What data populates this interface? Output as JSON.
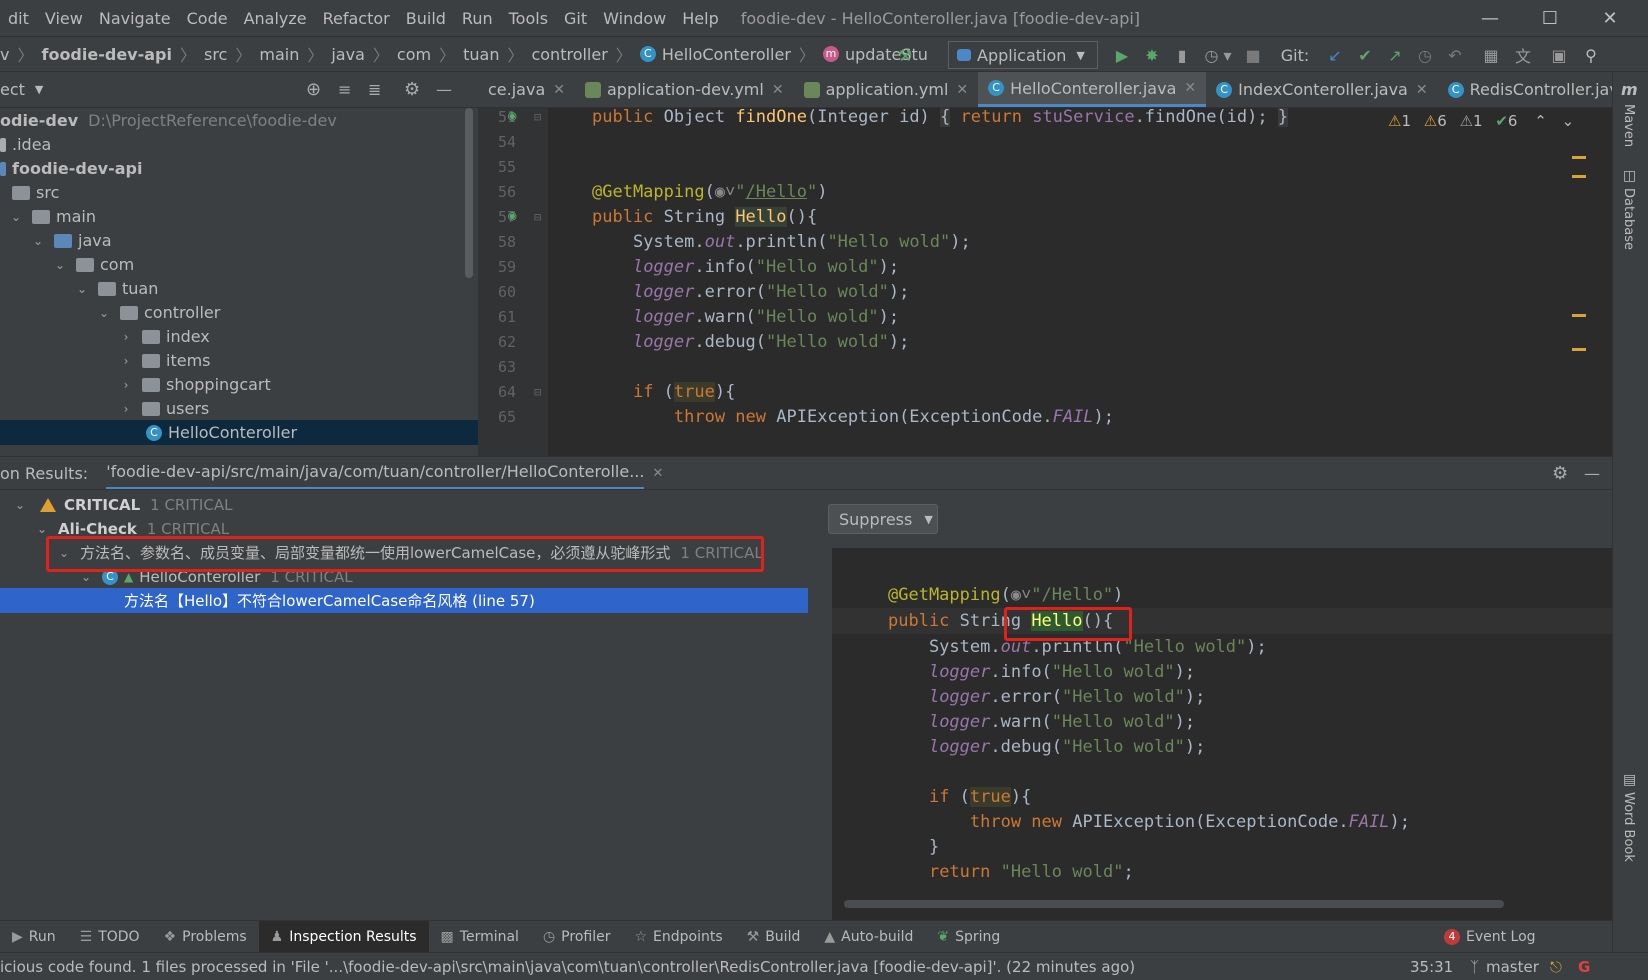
{
  "menu": {
    "items": [
      "dit",
      "View",
      "Navigate",
      "Code",
      "Analyze",
      "Refactor",
      "Build",
      "Run",
      "Tools",
      "Git",
      "Window",
      "Help"
    ],
    "window_title": "foodie-dev - HelloConteroller.java [foodie-dev-api]"
  },
  "navbar": {
    "crumbs": [
      "v",
      "foodie-dev-api",
      "src",
      "main",
      "java",
      "com",
      "tuan",
      "controller",
      "HelloConteroller",
      "updateStu"
    ],
    "run_config": "Application",
    "git_label": "Git:"
  },
  "project": {
    "header": "ect",
    "rows": [
      {
        "label": "odie-dev",
        "extra": "D:\\ProjectReference\\foodie-dev",
        "bold": true
      },
      {
        "label": ".idea"
      },
      {
        "label": "foodie-dev-api",
        "bold": true
      },
      {
        "label": "src"
      },
      {
        "label": "main"
      },
      {
        "label": "java"
      },
      {
        "label": "com"
      },
      {
        "label": "tuan"
      },
      {
        "label": "controller"
      },
      {
        "label": "index"
      },
      {
        "label": "items"
      },
      {
        "label": "shoppingcart"
      },
      {
        "label": "users"
      },
      {
        "label": "HelloConteroller"
      }
    ]
  },
  "tabs": [
    {
      "label": "ce.java",
      "active": false
    },
    {
      "label": "application-dev.yml",
      "active": false
    },
    {
      "label": "application.yml",
      "active": false
    },
    {
      "label": "HelloConteroller.java",
      "active": true
    },
    {
      "label": "IndexConteroller.java",
      "active": false
    },
    {
      "label": "RedisController.java",
      "active": false
    }
  ],
  "editor": {
    "line_numbers": [
      "51",
      "54",
      "55",
      "56",
      "57",
      "58",
      "59",
      "60",
      "61",
      "62",
      "63",
      "64",
      "65"
    ],
    "warnings": {
      "w1": "1",
      "w2": "6",
      "w3": "1",
      "ok": "6"
    }
  },
  "inspection": {
    "header": "on Results:",
    "scope_tab": "'foodie-dev-api/src/main/java/com/tuan/controller/HelloConterolle...",
    "critical_label": "CRITICAL",
    "critical_count": "1 CRITICAL",
    "alicheck_label": "Ali-Check",
    "alicheck_count": "1 CRITICAL",
    "rule_label": "方法名、参数名、成员变量、局部变量都统一使用lowerCamelCase，必须遵从驼峰形式",
    "rule_count": "1 CRITICAL",
    "class_label": "HelloConteroller",
    "class_count": "1 CRITICAL",
    "problem_label": "方法名【Hello】不符合lowerCamelCase命名风格 (line 57)",
    "suppress_label": "Suppress"
  },
  "right_strip": {
    "maven": "Maven",
    "database": "Database",
    "wordbook": "Word Book"
  },
  "toolwindows": [
    "Run",
    "TODO",
    "Problems",
    "Inspection Results",
    "Terminal",
    "Profiler",
    "Endpoints",
    "Build",
    "Auto-build",
    "Spring"
  ],
  "event_log": {
    "count": "4",
    "label": "Event Log"
  },
  "status": {
    "message": "icious code found. 1 files processed in 'File '...\\foodie-dev-api\\src\\main\\java\\com\\tuan\\controller\\RedisController.java [foodie-dev-api]'. (22 minutes ago)",
    "position": "35:31",
    "branch": "master"
  }
}
